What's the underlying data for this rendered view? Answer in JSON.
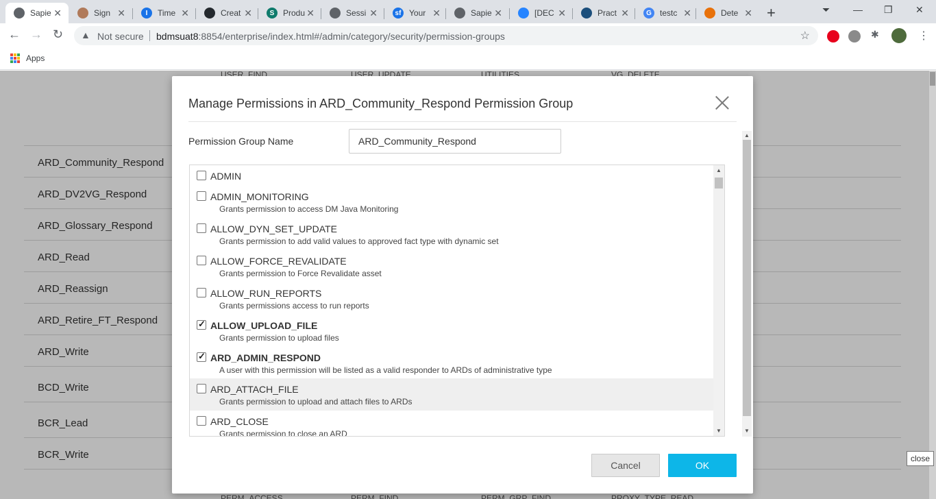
{
  "browser": {
    "tabs": [
      {
        "label": "Sapie",
        "favicon": "globe-icon",
        "color": "#5f6368",
        "active": true
      },
      {
        "label": "Sign",
        "favicon": "avatar-icon",
        "color": "#b07a5a"
      },
      {
        "label": "Time",
        "favicon": "i-icon",
        "color": "#1a73e8",
        "glyph": "I"
      },
      {
        "label": "Creat",
        "favicon": "github-icon",
        "color": "#24292e"
      },
      {
        "label": "Produ",
        "favicon": "sharepoint-icon",
        "color": "#0f7b6c",
        "glyph": "S"
      },
      {
        "label": "Sessi",
        "favicon": "globe-icon",
        "color": "#5f6368"
      },
      {
        "label": "Your",
        "favicon": "sf-icon",
        "color": "#1a73e8",
        "glyph": "sf"
      },
      {
        "label": "Sapie",
        "favicon": "globe-icon",
        "color": "#5f6368"
      },
      {
        "label": "[DEC",
        "favicon": "jira-icon",
        "color": "#2684ff"
      },
      {
        "label": "Pract",
        "favicon": "refresh-icon",
        "color": "#1c4f7c"
      },
      {
        "label": "testc",
        "favicon": "google-icon",
        "color": "#4285f4",
        "glyph": "G"
      },
      {
        "label": "Dete",
        "favicon": "fox-icon",
        "color": "#e8710a"
      }
    ],
    "address": {
      "security": "Not secure",
      "host": "bdmsuat8",
      "rest": ":8854/enterprise/index.html#/admin/category/security/permission-groups"
    },
    "bookmarks": {
      "apps_label": "Apps"
    }
  },
  "page": {
    "column_headers_top": [
      "USER_FIND",
      "USER_UPDATE",
      "UTILITIES",
      "VG_DELETE"
    ],
    "column_headers_bottom": [
      "PERM_ACCESS",
      "PERM_FIND",
      "PERM_GRP_FIND",
      "PROXY_TYPE_READ"
    ],
    "groups": [
      "ARD_Community_Respond",
      "ARD_DV2VG_Respond",
      "ARD_Glossary_Respond",
      "ARD_Read",
      "ARD_Reassign",
      "ARD_Retire_FT_Respond",
      "ARD_Write",
      "BCD_Write",
      "BCR_Lead",
      "BCR_Write"
    ]
  },
  "modal": {
    "title": "Manage Permissions in ARD_Community_Respond Permission Group",
    "group_name_label": "Permission Group Name",
    "group_name_value": "ARD_Community_Respond",
    "permissions": [
      {
        "name": "ADMIN",
        "description": "",
        "checked": false
      },
      {
        "name": "ADMIN_MONITORING",
        "description": "Grants permission to access DM Java Monitoring",
        "checked": false
      },
      {
        "name": "ALLOW_DYN_SET_UPDATE",
        "description": "Grants permission to add valid values to approved fact type with dynamic set",
        "checked": false
      },
      {
        "name": "ALLOW_FORCE_REVALIDATE",
        "description": "Grants permission to Force Revalidate asset",
        "checked": false
      },
      {
        "name": "ALLOW_RUN_REPORTS",
        "description": "Grants permissions access to run reports",
        "checked": false
      },
      {
        "name": "ALLOW_UPLOAD_FILE",
        "description": "Grants permission to upload files",
        "checked": true
      },
      {
        "name": "ARD_ADMIN_RESPOND",
        "description": "A user with this permission will be listed as a valid responder to ARDs of administrative type",
        "checked": true
      },
      {
        "name": "ARD_ATTACH_FILE",
        "description": "Grants permission to upload and attach files to ARDs",
        "checked": false,
        "highlighted": true
      },
      {
        "name": "ARD_CLOSE",
        "description": "Grants permission to close an ARD",
        "checked": false
      }
    ],
    "cancel_label": "Cancel",
    "ok_label": "OK"
  },
  "tooltip": "close",
  "colors": {
    "ok_button": "#0db6e8",
    "overlay": "rgba(0,0,0,0.28)"
  }
}
